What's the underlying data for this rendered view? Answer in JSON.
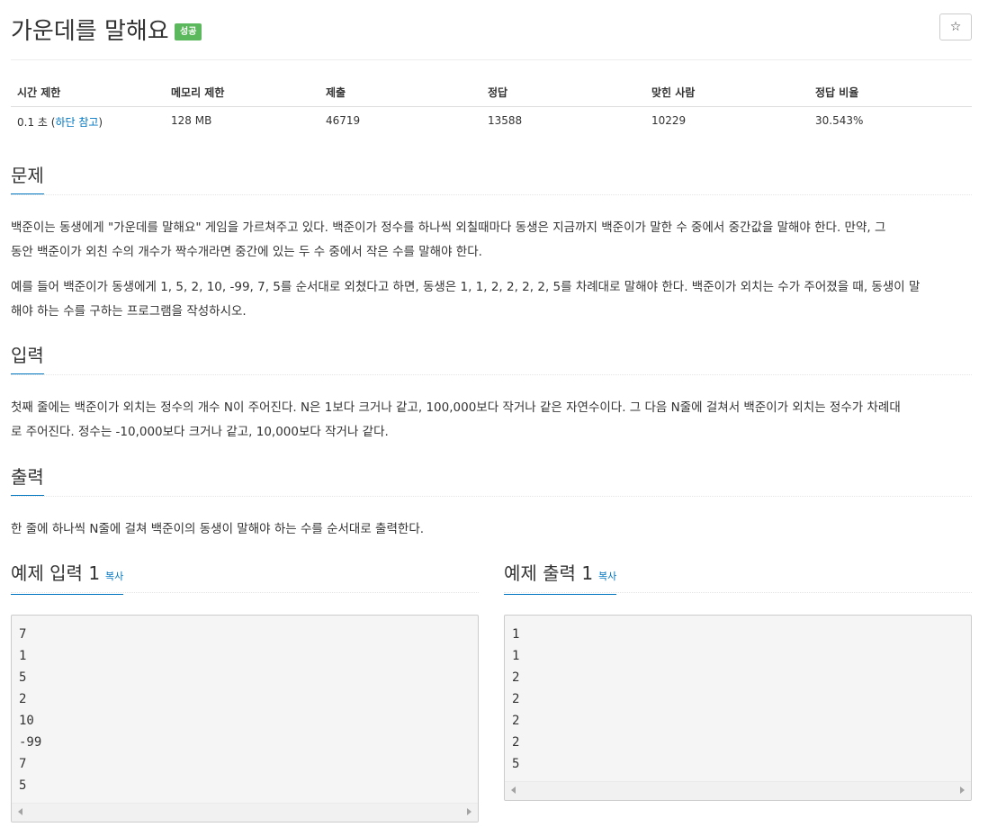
{
  "problem": {
    "title": "가운데를 말해요",
    "badge": "성공",
    "star_icon": "☆"
  },
  "info_table": {
    "headers": [
      "시간 제한",
      "메모리 제한",
      "제출",
      "정답",
      "맞힌 사람",
      "정답 비율"
    ],
    "time_limit": "0.1 초 (",
    "time_limit_link": "하단 참고",
    "time_limit_close": ")",
    "memory_limit": "128 MB",
    "submissions": "46719",
    "accepted": "13588",
    "solvers": "10229",
    "ratio": "30.543%"
  },
  "sections": {
    "problem_heading": "문제",
    "problem_p1_line1": "백준이는 동생에게 \"가운데를 말해요\" 게임을 가르쳐주고 있다. 백준이가 정수를 하나씩 외칠때마다 동생은 지금까지 백준이가 말한 수 중에서 중간값을 말해야 한다. 만약, 그",
    "problem_p1_line2": "동안 백준이가 외친 수의 개수가 짝수개라면 중간에 있는 두 수 중에서 작은 수를 말해야 한다.",
    "problem_p2_line1": "예를 들어 백준이가 동생에게 1, 5, 2, 10, -99, 7, 5를 순서대로 외쳤다고 하면, 동생은 1, 1, 2, 2, 2, 2, 5를 차례대로 말해야 한다. 백준이가 외치는 수가 주어졌을 때, 동생이 말",
    "problem_p2_line2": "해야 하는 수를 구하는 프로그램을 작성하시오.",
    "input_heading": "입력",
    "input_line1": "첫째 줄에는 백준이가 외치는 정수의 개수 N이 주어진다. N은 1보다 크거나 같고, 100,000보다 작거나 같은 자연수이다. 그 다음 N줄에 걸쳐서 백준이가 외치는 정수가 차례대",
    "input_line2": "로 주어진다. 정수는 -10,000보다 크거나 같고, 10,000보다 작거나 같다.",
    "output_heading": "출력",
    "output_line1": "한 줄에 하나씩 N줄에 걸쳐 백준이의 동생이 말해야 하는 수를 순서대로 출력한다."
  },
  "samples": {
    "input_heading": "예제 입력 1",
    "output_heading": "예제 출력 1",
    "copy_label": "복사",
    "input_lines": [
      "7",
      "1",
      "5",
      "2",
      "10",
      "-99",
      "7",
      "5"
    ],
    "output_lines": [
      "1",
      "1",
      "2",
      "2",
      "2",
      "2",
      "5"
    ]
  }
}
